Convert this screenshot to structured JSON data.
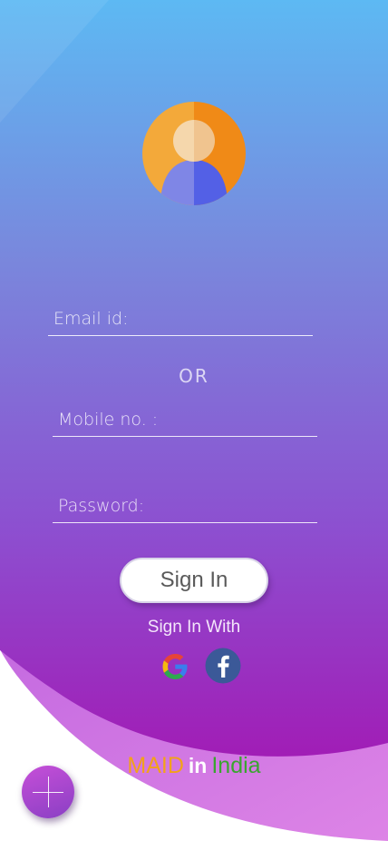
{
  "form": {
    "email_placeholder": "Email id:",
    "or_label": "OR",
    "mobile_placeholder": "Mobile no. :",
    "password_placeholder": "Password:"
  },
  "actions": {
    "sign_in_label": "Sign In",
    "sign_in_with_label": "Sign In With"
  },
  "social": {
    "google_icon": "google-icon",
    "facebook_icon": "facebook-icon"
  },
  "brand": {
    "word1": "MAID",
    "word2": "in",
    "word3": "India",
    "word1_color": "#f2a21a",
    "word2_color": "#ffffff",
    "word3_color": "#3aa52f"
  },
  "fab": {
    "icon": "plus-icon"
  },
  "colors": {
    "gradient_top": "#5db8f2",
    "gradient_mid": "#8a5fd6",
    "gradient_bottom": "#a320b8",
    "wave_light": "#d77de3"
  }
}
